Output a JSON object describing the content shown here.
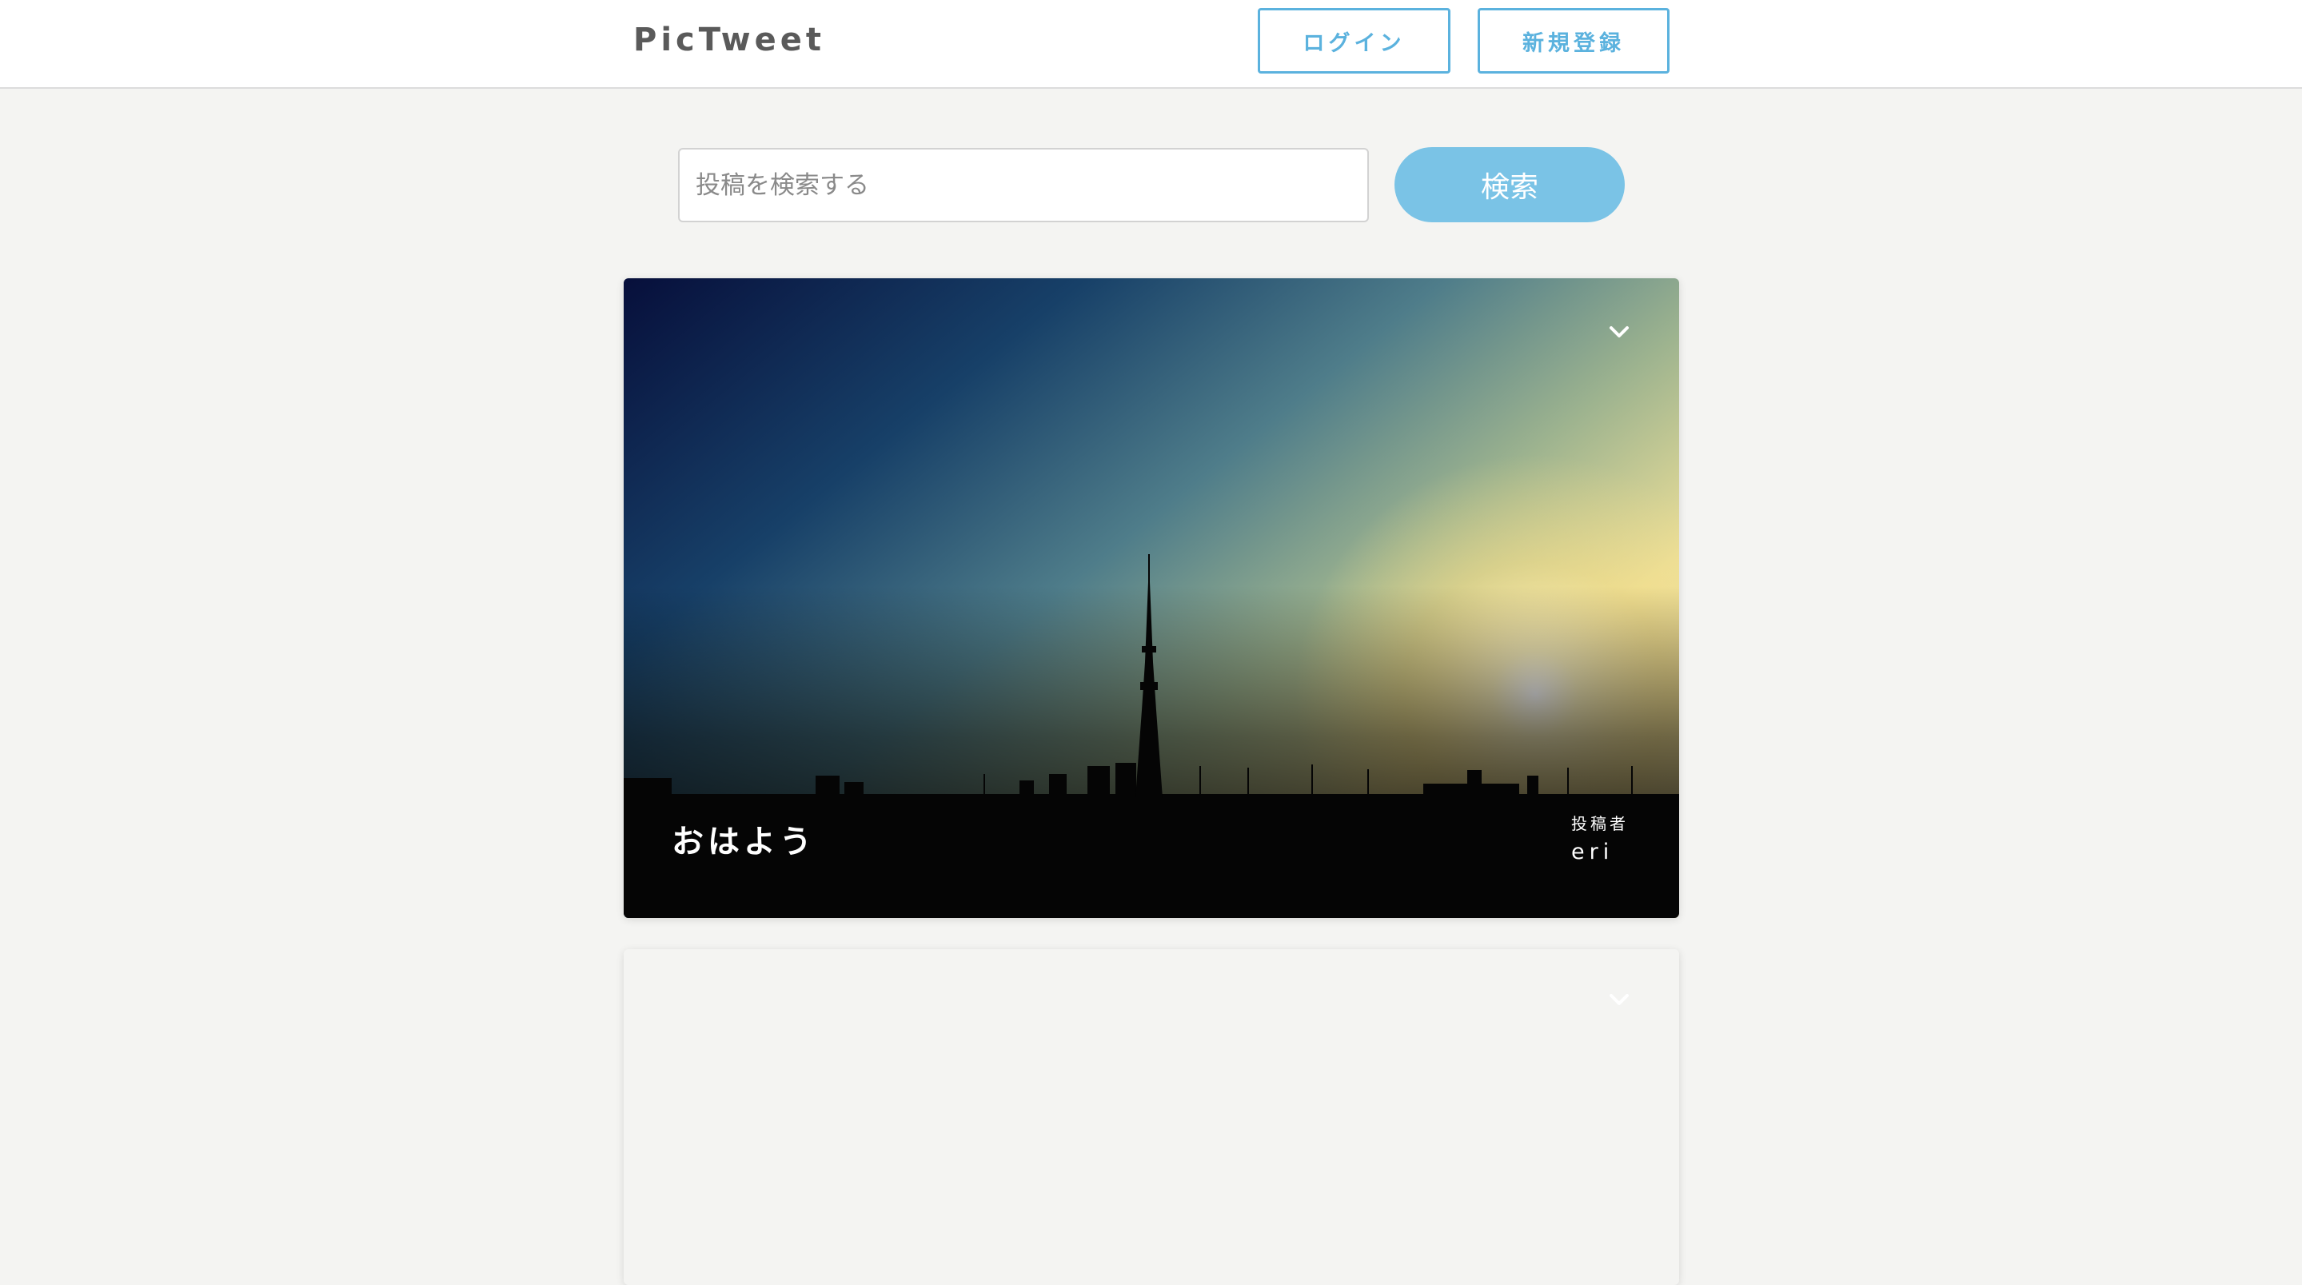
{
  "header": {
    "logo": "PicTweet",
    "login_label": "ログイン",
    "signup_label": "新規登録"
  },
  "search": {
    "placeholder": "投稿を検索する",
    "value": "",
    "button_label": "検索"
  },
  "colors": {
    "accent": "#5bb2de",
    "search_button": "#7ac3e6",
    "page_background": "#f4f4f2"
  },
  "posts": [
    {
      "text": "おはよう",
      "poster_label": "投稿者",
      "poster_name": "eri",
      "menu_icon": "chevron-down-icon",
      "image": "skyline-sunset-photo"
    },
    {
      "text": "",
      "poster_label": "",
      "poster_name": "",
      "menu_icon": "chevron-down-icon"
    }
  ]
}
